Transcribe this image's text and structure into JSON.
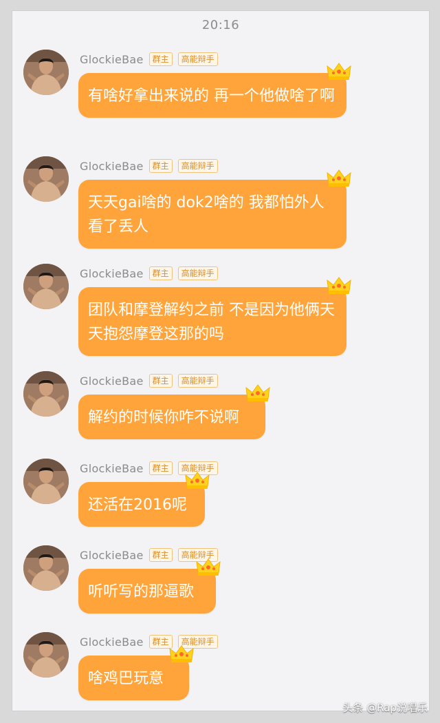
{
  "chat": {
    "time": "20:16",
    "messages": [
      {
        "nickname": "GlockieBae",
        "badge1": "群主",
        "badge2": "高能辩手",
        "text": "有啥好拿出来说的 再一个他做啥了啊"
      },
      {
        "nickname": "GlockieBae",
        "badge1": "群主",
        "badge2": "高能辩手",
        "text": "天天gai啥的 dok2啥的 我都怕外人看了丢人"
      },
      {
        "nickname": "GlockieBae",
        "badge1": "群主",
        "badge2": "高能辩手",
        "text": "团队和摩登解约之前 不是因为他俩天天抱怨摩登这那的吗"
      },
      {
        "nickname": "GlockieBae",
        "badge1": "群主",
        "badge2": "高能辩手",
        "text": "解约的时候你咋不说啊"
      },
      {
        "nickname": "GlockieBae",
        "badge1": "群主",
        "badge2": "高能辩手",
        "text": "还活在2016呢"
      },
      {
        "nickname": "GlockieBae",
        "badge1": "群主",
        "badge2": "高能辩手",
        "text": "听听写的那逼歌"
      },
      {
        "nickname": "GlockieBae",
        "badge1": "群主",
        "badge2": "高能辩手",
        "text": "啥鸡巴玩意"
      }
    ]
  },
  "watermark": {
    "text": "头条 @Rap说唱乐"
  },
  "colors": {
    "bubble": "#ffa43a",
    "badge_border": "#f0c37d",
    "badge_text": "#d98d2a",
    "crown": "#ffcc00"
  },
  "icons": {
    "avatar": "avatar",
    "crown": "crown-icon"
  }
}
